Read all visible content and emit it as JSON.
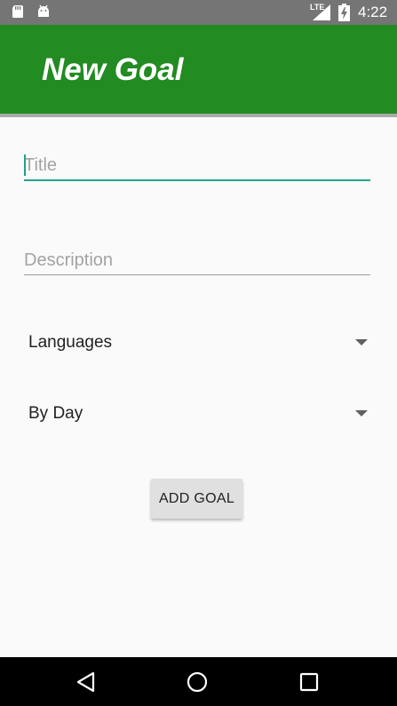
{
  "status_bar": {
    "time": "4:22",
    "network_label": "LTE",
    "icons": [
      "sd-card-icon",
      "android-icon",
      "signal-icon",
      "battery-charging-icon"
    ]
  },
  "app_bar": {
    "title": "New Goal",
    "color": "#228b22"
  },
  "form": {
    "title_field": {
      "placeholder": "Title",
      "value": ""
    },
    "description_field": {
      "placeholder": "Description",
      "value": ""
    },
    "category_spinner": {
      "selected": "Languages"
    },
    "frequency_spinner": {
      "selected": "By Day"
    },
    "submit_label": "ADD GOAL",
    "accent_color": "#26a08a"
  },
  "nav_bar": {
    "icons": [
      "back-icon",
      "home-icon",
      "recent-apps-icon"
    ]
  }
}
